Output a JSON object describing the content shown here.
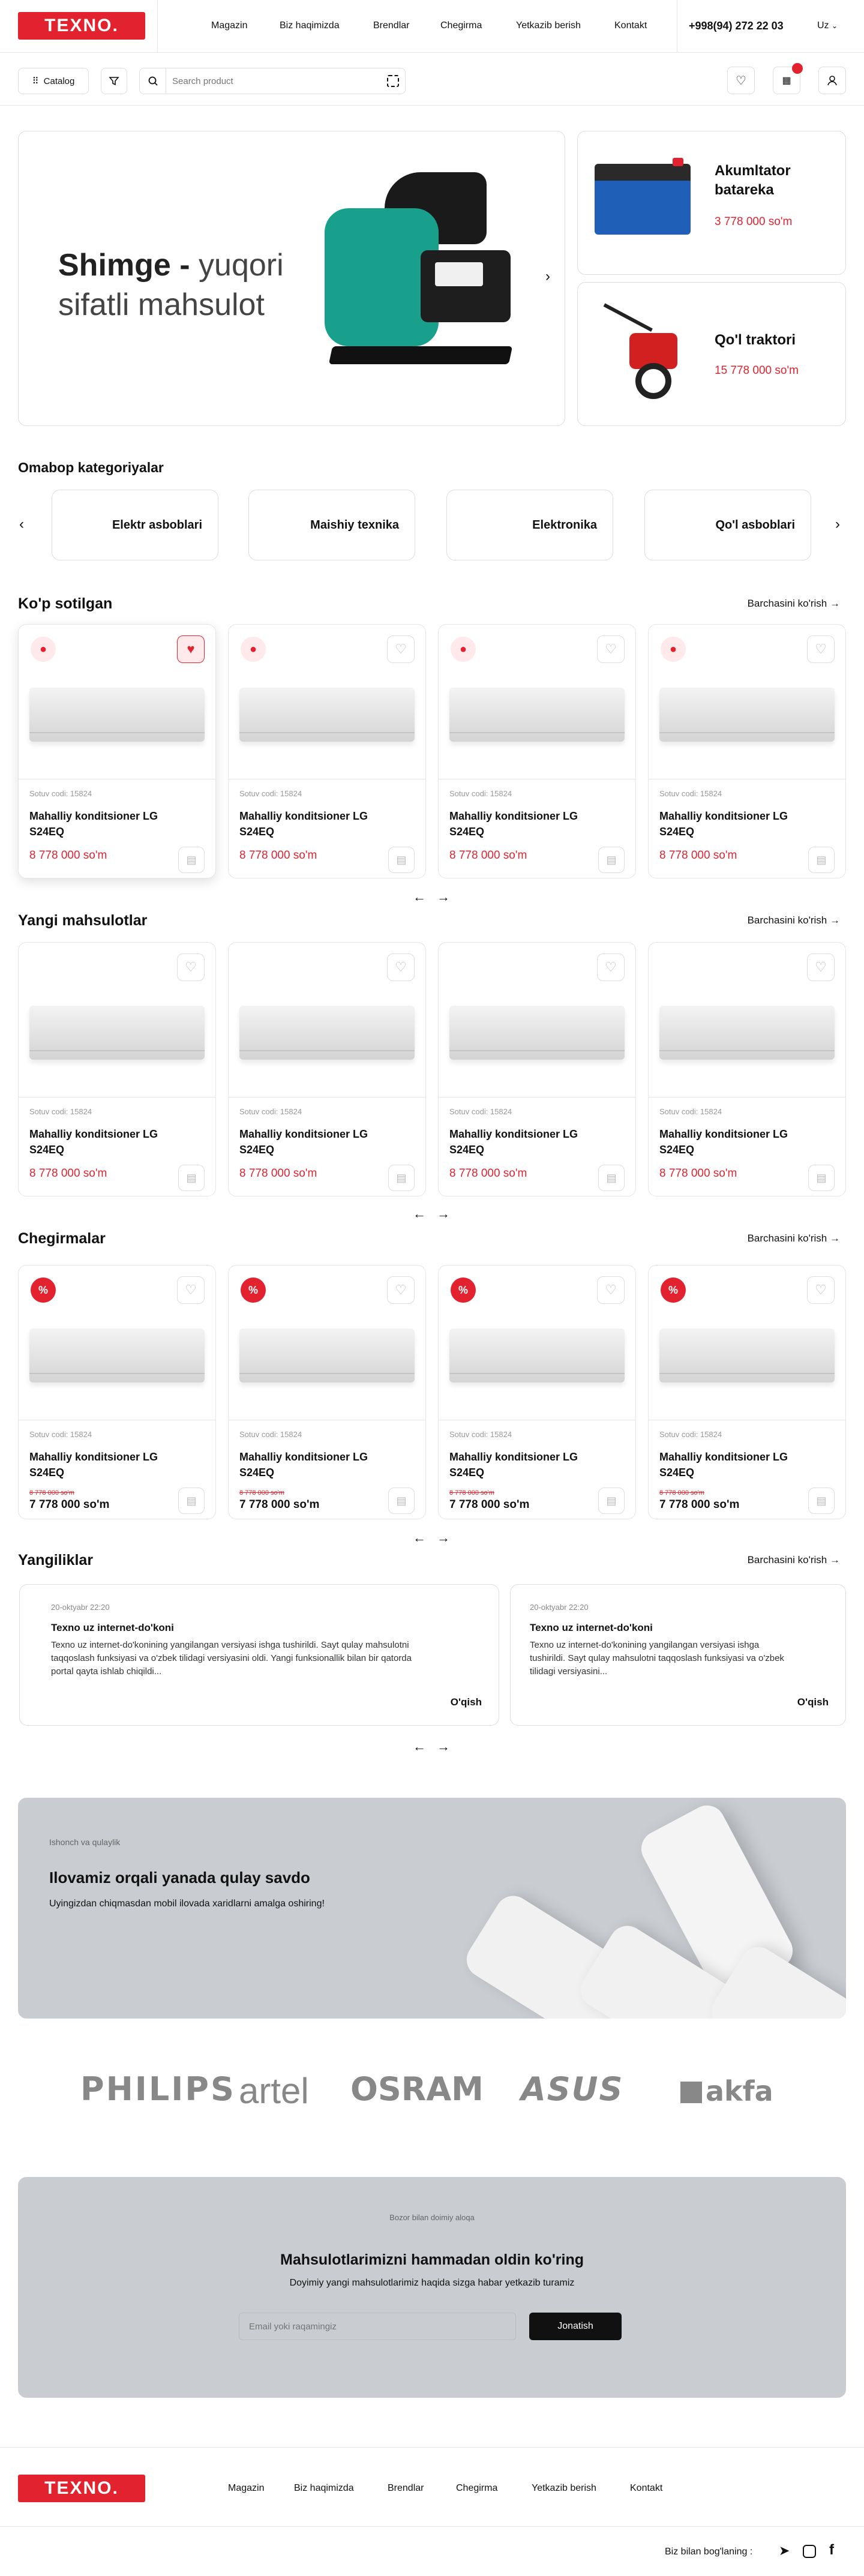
{
  "header": {
    "logo": "TEXNO.",
    "nav": [
      "Magazin",
      "Biz haqimizda",
      "Brendlar",
      "Chegirma",
      "Yetkazib berish",
      "Kontakt"
    ],
    "phone": "+998(94) 272 22 03",
    "lang": "Uz"
  },
  "toolbar": {
    "catalog": "Catalog",
    "search_placeholder": "Search product",
    "icons": [
      "filter-icon",
      "search-icon",
      "scan-icon",
      "heart-icon",
      "store-icon",
      "user-icon"
    ]
  },
  "hero": {
    "brand": "Shimge",
    "dash": " - ",
    "line1": "yuqori",
    "line2": "sifatli mahsulot",
    "side": [
      {
        "title": "Akumltator batareka",
        "price": "3 778 000 so'm"
      },
      {
        "title": "Qo'l traktori",
        "price": "15 778 000 so'm"
      }
    ]
  },
  "categories": {
    "title": "Omabop kategoriyalar",
    "items": [
      "Elektr asboblari",
      "Maishiy texnika",
      "Elektronika",
      "Qo'l asboblari"
    ]
  },
  "sections": [
    {
      "title": "Ko'p sotilgan",
      "see_all": "Barchasini ko'rish"
    },
    {
      "title": "Yangi mahsulotlar",
      "see_all": "Barchasini ko'rish"
    },
    {
      "title": "Chegirmalar",
      "see_all": "Barchasini ko'rish"
    },
    {
      "title": "Yangiliklar",
      "see_all": "Barchasini ko'rish"
    }
  ],
  "product": {
    "code": "Sotuv codi: 15824",
    "name": "Mahalliy konditsioner LG S24EQ",
    "price": "8 778 000 so'm",
    "old_price": "8 778 000 so'm",
    "discount_price": "7 778 000 so'm"
  },
  "news": [
    {
      "date": "20-oktyabr 22:20",
      "title": "Texno uz internet-do'koni",
      "text": "Texno uz internet-do'konining yangilangan versiyasi ishga tushirildi. Sayt qulay mahsulotni taqqoslash funksiyasi va o'zbek tilidagi versiyasini oldi. Yangi funksionallik bilan bir qatorda portal qayta ishlab chiqildi...",
      "more": "O'qish"
    },
    {
      "date": "20-oktyabr 22:20",
      "title": "Texno uz internet-do'koni",
      "text": "Texno uz internet-do'konining yangilangan versiyasi ishga tushirildi. Sayt qulay mahsulotni taqqoslash funksiyasi va o'zbek tilidagi versiyasini...",
      "more": "O'qish"
    }
  ],
  "app_banner": {
    "kicker": "Ishonch va qulaylik",
    "title": "Ilovamiz orqali yanada qulay savdo",
    "subtitle": "Uyingizdan chiqmasdan mobil ilovada xaridlarni amalga oshiring!"
  },
  "brands": [
    "PHILIPS",
    "artel",
    "OSRAM",
    "ASUS",
    "akfa"
  ],
  "newsletter": {
    "kicker": "Bozor bilan doimiy aloqa",
    "title": "Mahsulotlarimizni hammadan oldin ko'ring",
    "subtitle": "Doyimiy yangi mahsulotlarimiz haqida sizga habar yetkazib turamiz",
    "placeholder": "Email yoki raqamingiz",
    "button": "Jonatish"
  },
  "footer": {
    "logo": "TEXNO.",
    "nav": [
      "Magazin",
      "Biz haqimizda",
      "Brendlar",
      "Chegirma",
      "Yetkazib berish",
      "Kontakt"
    ],
    "social_label": "Biz bilan bog'laning :"
  },
  "colors": {
    "accent": "#e3222f",
    "banner_bg": "#c9ccd1"
  }
}
